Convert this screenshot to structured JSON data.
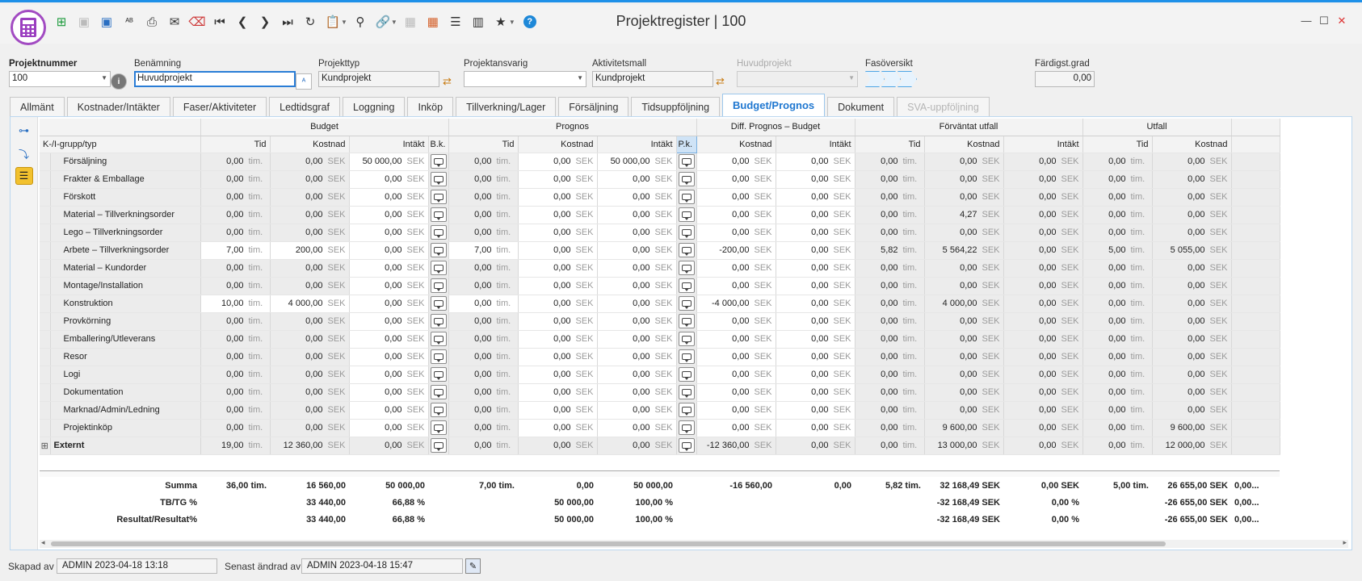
{
  "window": {
    "title": "Projektregister | 100"
  },
  "toolbar": {
    "icons": [
      "new-icon",
      "save-icon",
      "save-as-icon",
      "spell-icon",
      "print-icon",
      "mail-icon",
      "delete-icon",
      "first-record-icon",
      "previous-record-icon",
      "next-record-icon",
      "last-record-icon",
      "refresh-icon",
      "clipboard-icon",
      "search-icon",
      "link-icon",
      "grid-icon",
      "apps-icon",
      "settings-icon",
      "library-icon",
      "favorite-icon",
      "help-icon"
    ]
  },
  "fields": {
    "projektnummer": {
      "label": "Projektnummer",
      "value": "100"
    },
    "benamning": {
      "label": "Benämning",
      "value": "Huvudprojekt"
    },
    "projekttyp": {
      "label": "Projekttyp",
      "value": "Kundprojekt"
    },
    "projektansvarig": {
      "label": "Projektansvarig",
      "value": ""
    },
    "aktivitetsmall": {
      "label": "Aktivitetsmall",
      "value": "Kundprojekt"
    },
    "huvudprojekt": {
      "label": "Huvudprojekt",
      "value": ""
    },
    "fasoversikt": {
      "label": "Fasöversikt"
    },
    "fardigstgrad": {
      "label": "Färdigst.grad",
      "value": "0,00"
    }
  },
  "tabs": [
    "Allmänt",
    "Kostnader/Intäkter",
    "Faser/Aktiviteter",
    "Ledtidsgraf",
    "Loggning",
    "Inköp",
    "Tillverkning/Lager",
    "Försäljning",
    "Tidsuppföljning",
    "Budget/Prognos",
    "Dokument",
    "SVA-uppföljning"
  ],
  "active_tab": "Budget/Prognos",
  "grid": {
    "groups": [
      "Budget",
      "Prognos",
      "Diff. Prognos – Budget",
      "Förväntat utfall",
      "Utfall"
    ],
    "columns": {
      "label": "K-/I-grupp/typ",
      "tid": "Tid",
      "kostnad": "Kostnad",
      "intakt": "Intäkt",
      "bk": "B.k.",
      "pk": "P.k."
    },
    "units": {
      "tim": "tim.",
      "sek": "SEK"
    },
    "rows": [
      {
        "name": "Försäljning",
        "b_tid": "0,00",
        "b_kost": "0,00",
        "b_int": "50 000,00",
        "p_tid": "0,00",
        "p_kost": "0,00",
        "p_int": "50 000,00",
        "d_kost": "0,00",
        "d_int": "0,00",
        "f_tid": "0,00",
        "f_kost": "0,00",
        "f_int": "0,00",
        "u_tid": "0,00",
        "u_kost": "0,00"
      },
      {
        "name": "Frakter & Emballage",
        "b_tid": "0,00",
        "b_kost": "0,00",
        "b_int": "0,00",
        "p_tid": "0,00",
        "p_kost": "0,00",
        "p_int": "0,00",
        "d_kost": "0,00",
        "d_int": "0,00",
        "f_tid": "0,00",
        "f_kost": "0,00",
        "f_int": "0,00",
        "u_tid": "0,00",
        "u_kost": "0,00"
      },
      {
        "name": "Förskott",
        "b_tid": "0,00",
        "b_kost": "0,00",
        "b_int": "0,00",
        "p_tid": "0,00",
        "p_kost": "0,00",
        "p_int": "0,00",
        "d_kost": "0,00",
        "d_int": "0,00",
        "f_tid": "0,00",
        "f_kost": "0,00",
        "f_int": "0,00",
        "u_tid": "0,00",
        "u_kost": "0,00"
      },
      {
        "name": "Material – Tillverkningsorder",
        "b_tid": "0,00",
        "b_kost": "0,00",
        "b_int": "0,00",
        "p_tid": "0,00",
        "p_kost": "0,00",
        "p_int": "0,00",
        "d_kost": "0,00",
        "d_int": "0,00",
        "f_tid": "0,00",
        "f_kost": "4,27",
        "f_int": "0,00",
        "u_tid": "0,00",
        "u_kost": "0,00"
      },
      {
        "name": "Lego – Tillverkningsorder",
        "b_tid": "0,00",
        "b_kost": "0,00",
        "b_int": "0,00",
        "p_tid": "0,00",
        "p_kost": "0,00",
        "p_int": "0,00",
        "d_kost": "0,00",
        "d_int": "0,00",
        "f_tid": "0,00",
        "f_kost": "0,00",
        "f_int": "0,00",
        "u_tid": "0,00",
        "u_kost": "0,00"
      },
      {
        "name": "Arbete – Tillverkningsorder",
        "b_tid": "7,00",
        "b_kost": "200,00",
        "b_int": "0,00",
        "p_tid": "7,00",
        "p_kost": "0,00",
        "p_int": "0,00",
        "d_kost": "-200,00",
        "d_int": "0,00",
        "f_tid": "5,82",
        "f_kost": "5 564,22",
        "f_int": "0,00",
        "u_tid": "5,00",
        "u_kost": "5 055,00"
      },
      {
        "name": "Material – Kundorder",
        "b_tid": "0,00",
        "b_kost": "0,00",
        "b_int": "0,00",
        "p_tid": "0,00",
        "p_kost": "0,00",
        "p_int": "0,00",
        "d_kost": "0,00",
        "d_int": "0,00",
        "f_tid": "0,00",
        "f_kost": "0,00",
        "f_int": "0,00",
        "u_tid": "0,00",
        "u_kost": "0,00"
      },
      {
        "name": "Montage/Installation",
        "b_tid": "0,00",
        "b_kost": "0,00",
        "b_int": "0,00",
        "p_tid": "0,00",
        "p_kost": "0,00",
        "p_int": "0,00",
        "d_kost": "0,00",
        "d_int": "0,00",
        "f_tid": "0,00",
        "f_kost": "0,00",
        "f_int": "0,00",
        "u_tid": "0,00",
        "u_kost": "0,00"
      },
      {
        "name": "Konstruktion",
        "b_tid": "10,00",
        "b_kost": "4 000,00",
        "b_int": "0,00",
        "p_tid": "0,00",
        "p_kost": "0,00",
        "p_int": "0,00",
        "d_kost": "-4 000,00",
        "d_int": "0,00",
        "f_tid": "0,00",
        "f_kost": "4 000,00",
        "f_int": "0,00",
        "u_tid": "0,00",
        "u_kost": "0,00"
      },
      {
        "name": "Provkörning",
        "b_tid": "0,00",
        "b_kost": "0,00",
        "b_int": "0,00",
        "p_tid": "0,00",
        "p_kost": "0,00",
        "p_int": "0,00",
        "d_kost": "0,00",
        "d_int": "0,00",
        "f_tid": "0,00",
        "f_kost": "0,00",
        "f_int": "0,00",
        "u_tid": "0,00",
        "u_kost": "0,00"
      },
      {
        "name": "Emballering/Utleverans",
        "b_tid": "0,00",
        "b_kost": "0,00",
        "b_int": "0,00",
        "p_tid": "0,00",
        "p_kost": "0,00",
        "p_int": "0,00",
        "d_kost": "0,00",
        "d_int": "0,00",
        "f_tid": "0,00",
        "f_kost": "0,00",
        "f_int": "0,00",
        "u_tid": "0,00",
        "u_kost": "0,00"
      },
      {
        "name": "Resor",
        "b_tid": "0,00",
        "b_kost": "0,00",
        "b_int": "0,00",
        "p_tid": "0,00",
        "p_kost": "0,00",
        "p_int": "0,00",
        "d_kost": "0,00",
        "d_int": "0,00",
        "f_tid": "0,00",
        "f_kost": "0,00",
        "f_int": "0,00",
        "u_tid": "0,00",
        "u_kost": "0,00"
      },
      {
        "name": "Logi",
        "b_tid": "0,00",
        "b_kost": "0,00",
        "b_int": "0,00",
        "p_tid": "0,00",
        "p_kost": "0,00",
        "p_int": "0,00",
        "d_kost": "0,00",
        "d_int": "0,00",
        "f_tid": "0,00",
        "f_kost": "0,00",
        "f_int": "0,00",
        "u_tid": "0,00",
        "u_kost": "0,00"
      },
      {
        "name": "Dokumentation",
        "b_tid": "0,00",
        "b_kost": "0,00",
        "b_int": "0,00",
        "p_tid": "0,00",
        "p_kost": "0,00",
        "p_int": "0,00",
        "d_kost": "0,00",
        "d_int": "0,00",
        "f_tid": "0,00",
        "f_kost": "0,00",
        "f_int": "0,00",
        "u_tid": "0,00",
        "u_kost": "0,00"
      },
      {
        "name": "Marknad/Admin/Ledning",
        "b_tid": "0,00",
        "b_kost": "0,00",
        "b_int": "0,00",
        "p_tid": "0,00",
        "p_kost": "0,00",
        "p_int": "0,00",
        "d_kost": "0,00",
        "d_int": "0,00",
        "f_tid": "0,00",
        "f_kost": "0,00",
        "f_int": "0,00",
        "u_tid": "0,00",
        "u_kost": "0,00"
      },
      {
        "name": "Projektinköp",
        "b_tid": "0,00",
        "b_kost": "0,00",
        "b_int": "0,00",
        "p_tid": "0,00",
        "p_kost": "0,00",
        "p_int": "0,00",
        "d_kost": "0,00",
        "d_int": "0,00",
        "f_tid": "0,00",
        "f_kost": "9 600,00",
        "f_int": "0,00",
        "u_tid": "0,00",
        "u_kost": "9 600,00"
      }
    ],
    "external": {
      "name": "Externt",
      "b_tid": "19,00",
      "b_kost": "12 360,00",
      "b_int": "0,00",
      "p_tid": "0,00",
      "p_kost": "0,00",
      "p_int": "0,00",
      "d_kost": "-12 360,00",
      "d_int": "0,00",
      "f_tid": "0,00",
      "f_kost": "13 000,00",
      "f_int": "0,00",
      "u_tid": "0,00",
      "u_kost": "12 000,00"
    },
    "summary": [
      {
        "label": "Summa",
        "b_tid": "36,00 tim.",
        "b_kost": "16 560,00",
        "b_int": "50 000,00",
        "p_tid": "7,00 tim.",
        "p_kost": "0,00",
        "p_int": "50 000,00",
        "d_kost": "-16 560,00",
        "d_int": "0,00",
        "f_tid": "5,82 tim.",
        "f_kost": "32 168,49 SEK",
        "f_int": "0,00 SEK",
        "u_tid": "5,00 tim.",
        "u_kost": "26 655,00 SEK",
        "extra": "0,00..."
      },
      {
        "label": "TB/TG %",
        "b_tid": "",
        "b_kost": "33 440,00",
        "b_int": "66,88 %",
        "p_tid": "",
        "p_kost": "50 000,00",
        "p_int": "100,00 %",
        "d_kost": "",
        "d_int": "",
        "f_tid": "",
        "f_kost": "-32 168,49 SEK",
        "f_int": "0,00 %",
        "u_tid": "",
        "u_kost": "-26 655,00 SEK",
        "extra": "0,00..."
      },
      {
        "label": "Resultat/Resultat%",
        "b_tid": "",
        "b_kost": "33 440,00",
        "b_int": "66,88 %",
        "p_tid": "",
        "p_kost": "50 000,00",
        "p_int": "100,00 %",
        "d_kost": "",
        "d_int": "",
        "f_tid": "",
        "f_kost": "-32 168,49 SEK",
        "f_int": "0,00 %",
        "u_tid": "",
        "u_kost": "-26 655,00 SEK",
        "extra": "0,00..."
      }
    ]
  },
  "footer": {
    "created_label": "Skapad av",
    "created_value": "ADMIN 2023-04-18 13:18",
    "changed_label": "Senast ändrad av",
    "changed_value": "ADMIN 2023-04-18 15:47"
  }
}
